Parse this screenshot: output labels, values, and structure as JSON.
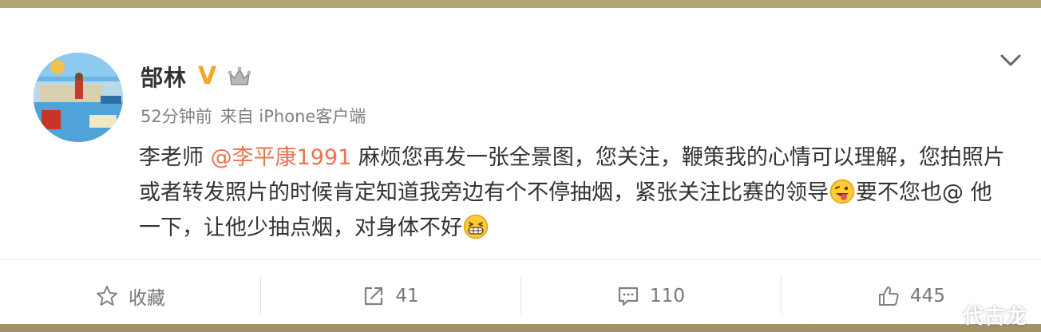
{
  "post": {
    "username": "郜林",
    "verified_badge": "V",
    "crown_icon": "crown-icon",
    "time": "52分钟前",
    "source": "来自 iPhone客户端",
    "text": {
      "part1": "李老师 ",
      "mention": "@李平康1991",
      "part2": " 麻烦您再发一张全景图，您关注，鞭策我的心情可以理解，您拍照片或者转发照片的时候肯定知道我旁边有个不停抽烟，紧张关注比赛的领导",
      "part3": "要不您也@ 他一下，让他少抽点烟，对身体不好"
    }
  },
  "actions": {
    "favorite_label": "收藏",
    "repost_count": "41",
    "comment_count": "110",
    "like_count": "445"
  },
  "watermark": "代古龙",
  "colors": {
    "accent": "#eb7350",
    "verified": "#f5a623",
    "text": "#333333",
    "meta": "#808080"
  }
}
